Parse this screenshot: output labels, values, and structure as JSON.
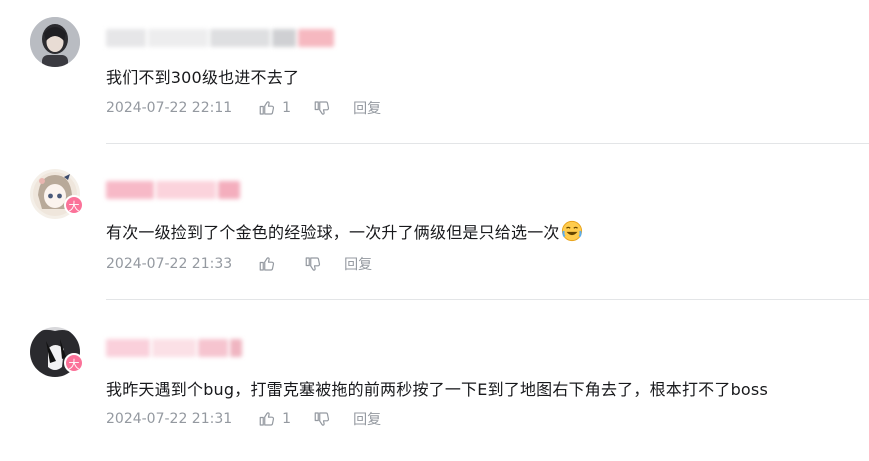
{
  "comments": [
    {
      "content": "我们不到300级也进不去了",
      "time": "2024-07-22 22:11",
      "like_count": "1",
      "reply_label": "回复",
      "badge": ""
    },
    {
      "content": "有次一级捡到了个金色的经验球，一次升了俩级但是只给选一次",
      "time": "2024-07-22 21:33",
      "like_count": "",
      "reply_label": "回复",
      "badge": "大",
      "emoji": "laughing-tears-emoji"
    },
    {
      "content": "我昨天遇到个bug，打雷克塞被拖的前两秒按了一下E到了地图右下角去了，根本打不了boss",
      "time": "2024-07-22 21:31",
      "like_count": "1",
      "reply_label": "回复",
      "badge": "大"
    }
  ],
  "icons": {
    "like": "thumbs-up-icon",
    "dislike": "thumbs-down-icon"
  },
  "colors": {
    "username_blur": "#f6b8c6",
    "badge": "#fb7299",
    "meta_text": "#9499a0",
    "divider": "#e3e5e7"
  }
}
